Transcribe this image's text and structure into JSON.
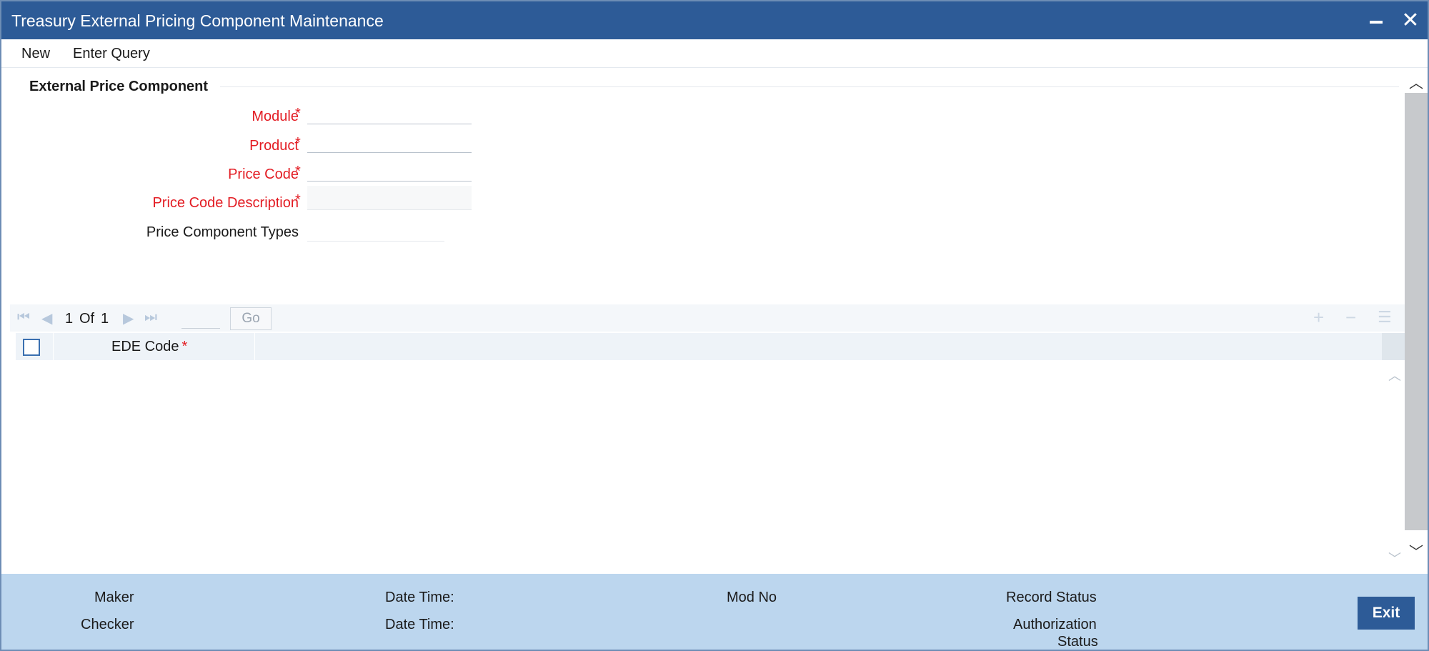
{
  "window": {
    "title": "Treasury External Pricing Component Maintenance",
    "close_glyph": "✕"
  },
  "menu": {
    "new": "New",
    "enter_query": "Enter Query"
  },
  "section": {
    "title": "External Price Component"
  },
  "fields": {
    "module": {
      "label": "Module",
      "value": ""
    },
    "product": {
      "label": "Product",
      "value": ""
    },
    "price_code": {
      "label": "Price Code",
      "value": ""
    },
    "price_code_description": {
      "label": "Price Code Description",
      "value": ""
    },
    "price_component_types": {
      "label": "Price Component Types",
      "value": ""
    },
    "required_mark": "*"
  },
  "grid": {
    "current_page": "1",
    "of_label": "Of",
    "total_pages": "1",
    "go_label": "Go",
    "columns": [
      {
        "label": "EDE Code",
        "required": "*"
      }
    ],
    "rows": []
  },
  "footer": {
    "maker": "Maker",
    "checker": "Checker",
    "date_time_1": "Date Time:",
    "date_time_2": "Date Time:",
    "mod_no": "Mod No",
    "record_status": "Record Status",
    "authorization_status_line1": "Authorization",
    "authorization_status_line2": "Status",
    "exit_label": "Exit"
  },
  "colors": {
    "titlebar": "#2d5b97",
    "required_label": "#e31c23",
    "footer": "#bcd6ee",
    "exit_button": "#2d5b97"
  }
}
